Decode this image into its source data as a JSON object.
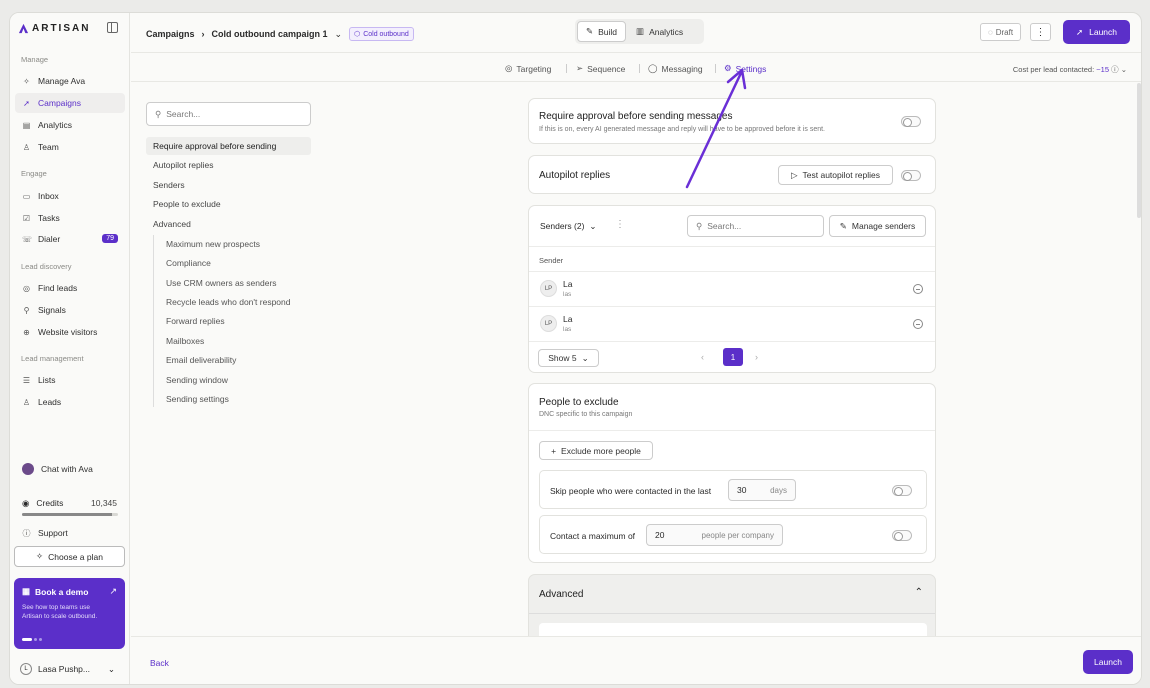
{
  "brand": {
    "name": "ARTISAN"
  },
  "sidebar": {
    "sections": [
      {
        "title": "Manage",
        "items": [
          {
            "label": "Manage Ava",
            "icon": "sparkle-icon"
          },
          {
            "label": "Campaigns",
            "icon": "rocket-icon",
            "active": true
          },
          {
            "label": "Analytics",
            "icon": "chart-icon"
          },
          {
            "label": "Team",
            "icon": "person-icon"
          }
        ]
      },
      {
        "title": "Engage",
        "items": [
          {
            "label": "Inbox",
            "icon": "inbox-icon"
          },
          {
            "label": "Tasks",
            "icon": "tasks-icon"
          },
          {
            "label": "Dialer",
            "icon": "phone-icon",
            "badge": "79"
          }
        ]
      },
      {
        "title": "Lead discovery",
        "items": [
          {
            "label": "Find leads",
            "icon": "target-icon"
          },
          {
            "label": "Signals",
            "icon": "signal-icon"
          },
          {
            "label": "Website visitors",
            "icon": "globe-icon"
          }
        ]
      },
      {
        "title": "Lead management",
        "items": [
          {
            "label": "Lists",
            "icon": "list-icon"
          },
          {
            "label": "Leads",
            "icon": "people-icon"
          }
        ]
      }
    ],
    "chat": "Chat with Ava",
    "credits": {
      "label": "Credits",
      "value": "10,345",
      "fill": 0.94
    },
    "support": "Support",
    "choose_plan": "Choose a plan",
    "demo": {
      "title": "Book a demo",
      "subtitle": "See how top teams use Artisan to scale outbound."
    },
    "user": {
      "initial": "L",
      "name": "Lasa Pushp..."
    }
  },
  "header": {
    "crumb_root": "Campaigns",
    "crumb_current": "Cold outbound campaign 1",
    "tag": "Cold outbound",
    "tabs": [
      "Build",
      "Analytics"
    ],
    "draft": "Draft",
    "launch": "Launch"
  },
  "subtabs": [
    "Targeting",
    "Sequence",
    "Messaging",
    "Settings"
  ],
  "cost": {
    "label": "Cost per lead contacted:",
    "value": "~15"
  },
  "leftnav": {
    "search_placeholder": "Search...",
    "items": [
      "Require approval before sending",
      "Autopilot replies",
      "Senders",
      "People to exclude",
      "Advanced"
    ],
    "advanced_items": [
      "Maximum new prospects",
      "Compliance",
      "Use CRM owners as senders",
      "Recycle leads who don't respond",
      "Forward replies",
      "Mailboxes",
      "Email deliverability",
      "Sending window",
      "Sending settings"
    ]
  },
  "approval": {
    "title": "Require approval before sending messages",
    "subtitle": "If this is on, every AI generated message and reply will have to be approved before it is sent."
  },
  "autopilot": {
    "title": "Autopilot replies",
    "test_button": "Test autopilot replies"
  },
  "senders": {
    "title": "Senders (2)",
    "search_placeholder": "Search...",
    "manage": "Manage senders",
    "column": "Sender",
    "rows": [
      {
        "initials": "LP",
        "name": "La",
        "sub": "las"
      },
      {
        "initials": "LP",
        "name": "La",
        "sub": "las"
      }
    ],
    "show": "Show 5",
    "page": "1"
  },
  "exclude": {
    "title": "People to exclude",
    "subtitle": "DNC specific to this campaign",
    "button": "Exclude more people",
    "skip_label": "Skip people who were contacted in the last",
    "skip_value": "30",
    "skip_unit": "days",
    "max_label": "Contact a maximum of",
    "max_value": "20",
    "max_unit": "people per company"
  },
  "advanced": {
    "title": "Advanced"
  },
  "footer": {
    "back": "Back",
    "launch": "Launch"
  },
  "colors": {
    "accent": "#5b2fc9",
    "annotation": "#6a2fd6"
  }
}
